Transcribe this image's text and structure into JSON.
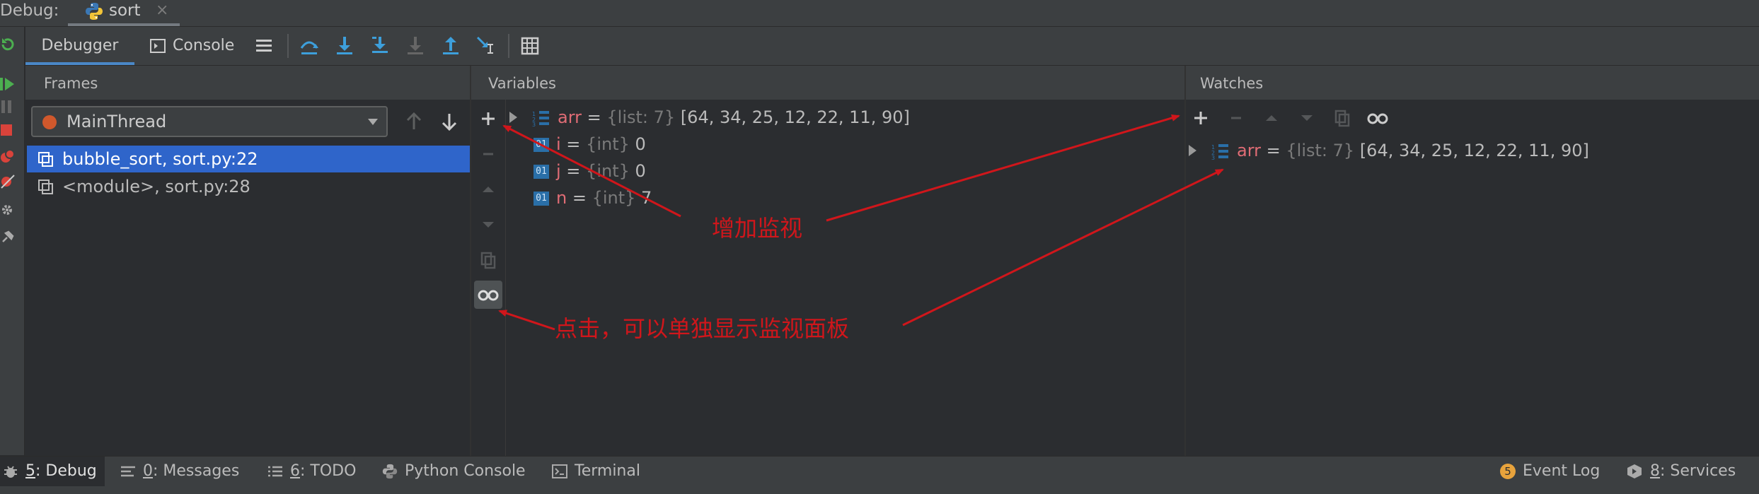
{
  "titlebar": {
    "label": "Debug:",
    "tab": "sort",
    "close": "×"
  },
  "toolbar": {
    "debugger_tab": "Debugger",
    "console_tab": "Console"
  },
  "frames": {
    "title": "Frames",
    "thread": "MainThread",
    "rows": [
      {
        "label": "bubble_sort, sort.py:22",
        "selected": true
      },
      {
        "label": "<module>, sort.py:28",
        "selected": false
      }
    ]
  },
  "variables": {
    "title": "Variables",
    "rows": [
      {
        "name": "arr",
        "eq": " = ",
        "type": "{list: 7}",
        "value": " [64, 34, 25, 12, 22, 11, 90]"
      },
      {
        "name": "i",
        "eq": " = ",
        "type": "{int}",
        "value": " 0"
      },
      {
        "name": "j",
        "eq": " = ",
        "type": "{int}",
        "value": " 0"
      },
      {
        "name": "n",
        "eq": " = ",
        "type": "{int}",
        "value": " 7"
      }
    ]
  },
  "watches": {
    "title": "Watches",
    "rows": [
      {
        "name": "arr",
        "eq": " = ",
        "type": "{list: 7}",
        "value": " [64, 34, 25, 12, 22, 11, 90]"
      }
    ]
  },
  "annotations": {
    "add_watch": "增加监视",
    "click_note": "点击，可以单独显示监视面板"
  },
  "bottombar": {
    "debug_num": "5",
    "debug_label": ": Debug",
    "messages_num": "0",
    "messages_label": ": Messages",
    "todo_num": "6",
    "todo_label": ": TODO",
    "python_console": "Python Console",
    "terminal": "Terminal",
    "event_badge": "5",
    "event_log": "Event Log",
    "services_num": "8",
    "services_label": ": Services"
  },
  "colors": {
    "accent_blue": "#2f65ca",
    "annotation_red": "#d0161b",
    "var_name": "#e06c75",
    "background": "#2b2d30"
  }
}
